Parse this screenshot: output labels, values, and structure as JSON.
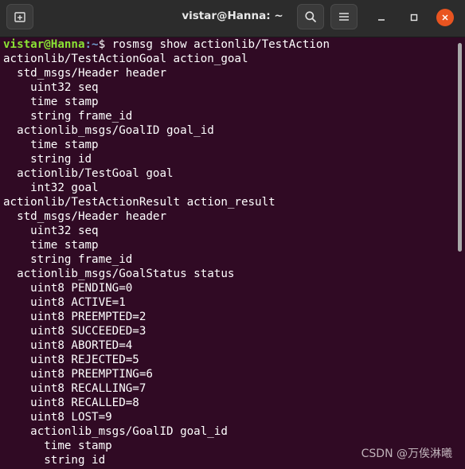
{
  "window": {
    "title": "vistar@Hanna: ~"
  },
  "icons": {
    "new_tab": "new-tab-icon",
    "search": "search-icon",
    "menu": "hamburger-menu-icon",
    "minimize": "minimize-icon",
    "maximize": "maximize-icon",
    "close": "close-icon"
  },
  "colors": {
    "terminal_bg": "#300a24",
    "prompt_user": "#8ae234",
    "text": "#ffffff",
    "close_button": "#e95420"
  },
  "prompt": {
    "user_host": "vistar@Hanna",
    "path": ":~",
    "symbol": "$",
    "command": " rosmsg show actionlib/TestAction"
  },
  "output_lines": [
    "actionlib/TestActionGoal action_goal",
    "  std_msgs/Header header",
    "    uint32 seq",
    "    time stamp",
    "    string frame_id",
    "  actionlib_msgs/GoalID goal_id",
    "    time stamp",
    "    string id",
    "  actionlib/TestGoal goal",
    "    int32 goal",
    "actionlib/TestActionResult action_result",
    "  std_msgs/Header header",
    "    uint32 seq",
    "    time stamp",
    "    string frame_id",
    "  actionlib_msgs/GoalStatus status",
    "    uint8 PENDING=0",
    "    uint8 ACTIVE=1",
    "    uint8 PREEMPTED=2",
    "    uint8 SUCCEEDED=3",
    "    uint8 ABORTED=4",
    "    uint8 REJECTED=5",
    "    uint8 PREEMPTING=6",
    "    uint8 RECALLING=7",
    "    uint8 RECALLED=8",
    "    uint8 LOST=9",
    "    actionlib_msgs/GoalID goal_id",
    "      time stamp",
    "      string id"
  ],
  "watermark": "CSDN @万俟淋曦"
}
